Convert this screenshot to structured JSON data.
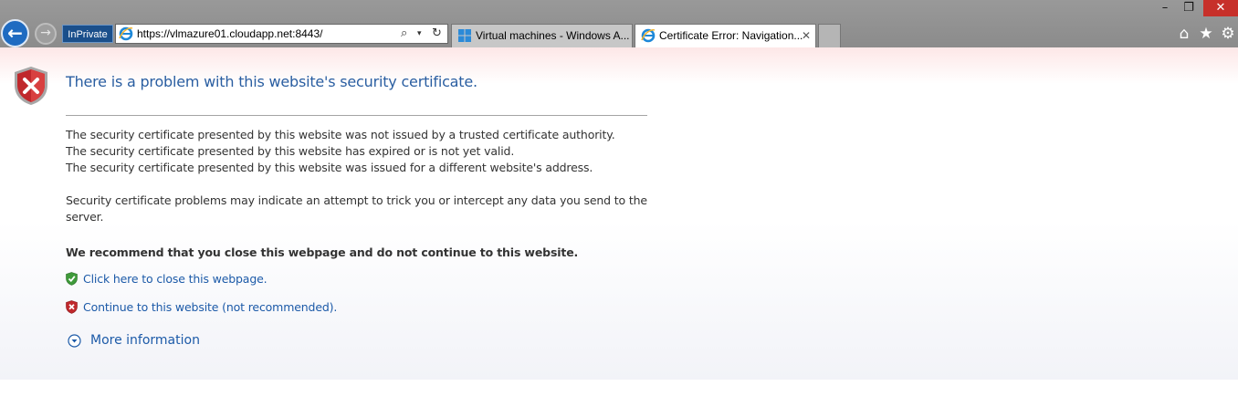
{
  "window": {
    "minimize_glyph": "–",
    "restore_glyph": "❐",
    "close_glyph": "✕"
  },
  "toolbar": {
    "back_glyph": "←",
    "forward_glyph": "→",
    "inprivate_label": "InPrivate",
    "address_url": "https://vlmazure01.cloudapp.net:8443/",
    "search_glyph": "⌕",
    "dropdown_glyph": "▾",
    "refresh_glyph": "↻"
  },
  "tabs": [
    {
      "label": "Virtual machines - Windows A...",
      "icon": "windows-logo-icon",
      "active": false
    },
    {
      "label": "Certificate Error: Navigation...",
      "icon": "ie-icon",
      "active": true,
      "close_glyph": "✕"
    }
  ],
  "tools": {
    "home_glyph": "⌂",
    "favorites_glyph": "★",
    "settings_glyph": "⚙"
  },
  "content": {
    "title": "There is a problem with this website's security certificate.",
    "reasons": [
      "The security certificate presented by this website was not issued by a trusted certificate authority.",
      "The security certificate presented by this website has expired or is not yet valid.",
      "The security certificate presented by this website was issued for a different website's address."
    ],
    "warning": "Security certificate problems may indicate an attempt to trick you or intercept any data you send to the server.",
    "recommendation": "We recommend that you close this webpage and do not continue to this website.",
    "close_link": "Click here to close this webpage.",
    "continue_link": "Continue to this website (not recommended).",
    "more_info": "More information"
  },
  "colors": {
    "chrome_bg": "#8b8b8b",
    "title_blue": "#2a5ea1",
    "link_blue": "#1c5aa8",
    "shield_red": "#c0282c",
    "shield_green": "#3f9a3a",
    "close_button_red": "#c7302a"
  }
}
